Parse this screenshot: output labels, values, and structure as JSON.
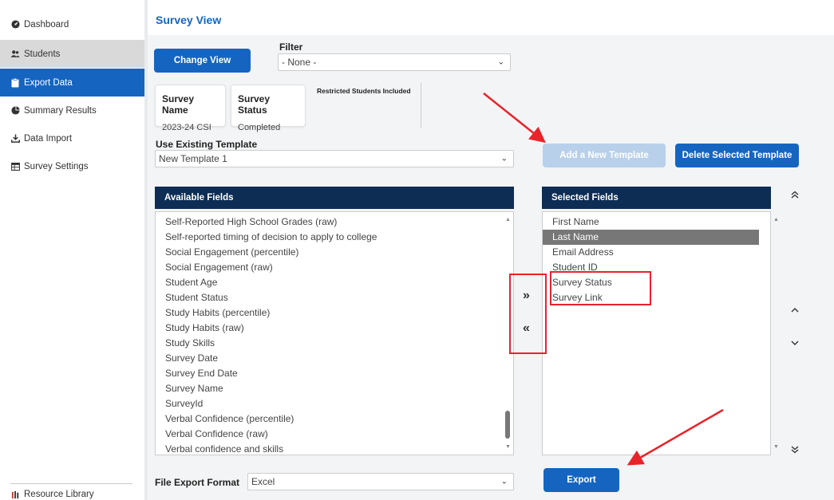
{
  "sidebar": {
    "items": [
      {
        "label": "Dashboard",
        "icon": "dashboard-icon"
      },
      {
        "label": "Students",
        "icon": "users-icon"
      },
      {
        "label": "Export Data",
        "icon": "clipboard-icon"
      },
      {
        "label": "Summary Results",
        "icon": "pie-chart-icon"
      },
      {
        "label": "Data Import",
        "icon": "download-icon"
      },
      {
        "label": "Survey Settings",
        "icon": "table-icon"
      }
    ],
    "footer": {
      "label": "Resource Library",
      "icon": "library-icon"
    }
  },
  "page": {
    "title": "Survey View"
  },
  "toolbar": {
    "change_view_label": "Change View",
    "filter_label": "Filter",
    "filter_value": "- None -"
  },
  "survey_card": {
    "name_header": "Survey Name",
    "name_value": "2023-24 CSI"
  },
  "status_card": {
    "status_header": "Survey Status",
    "status_value": "Completed"
  },
  "restricted_label": "Restricted Students Included",
  "template": {
    "label": "Use Existing Template",
    "value": "New Template 1",
    "add_label": "Add a New Template",
    "delete_label": "Delete Selected Template"
  },
  "available": {
    "header": "Available Fields",
    "items": [
      "Self-Reported High School Grades (raw)",
      "Self-reported timing of decision to apply to college",
      "Social Engagement (percentile)",
      "Social Engagement (raw)",
      "Student Age",
      "Student Status",
      "Study Habits (percentile)",
      "Study Habits (raw)",
      "Study Skills",
      "Survey Date",
      "Survey End Date",
      "Survey Name",
      "SurveyId",
      "Verbal Confidence (percentile)",
      "Verbal Confidence (raw)",
      "Verbal confidence and skills"
    ]
  },
  "selected": {
    "header": "Selected Fields",
    "items": [
      "First Name",
      "Last Name",
      "Email Address",
      "Student ID",
      "Survey Status",
      "Survey Link"
    ]
  },
  "controls": {
    "move_right": "»",
    "move_left": "«",
    "move_top": "⌃⌃",
    "move_up": "⌃",
    "move_down": "⌄",
    "move_bottom": "⌄⌄"
  },
  "export": {
    "format_label": "File Export Format",
    "format_value": "Excel",
    "export_label": "Export"
  },
  "colors": {
    "accent": "#1565c0",
    "header_navy": "#0d2d54",
    "annotation_red": "#e8232a"
  }
}
